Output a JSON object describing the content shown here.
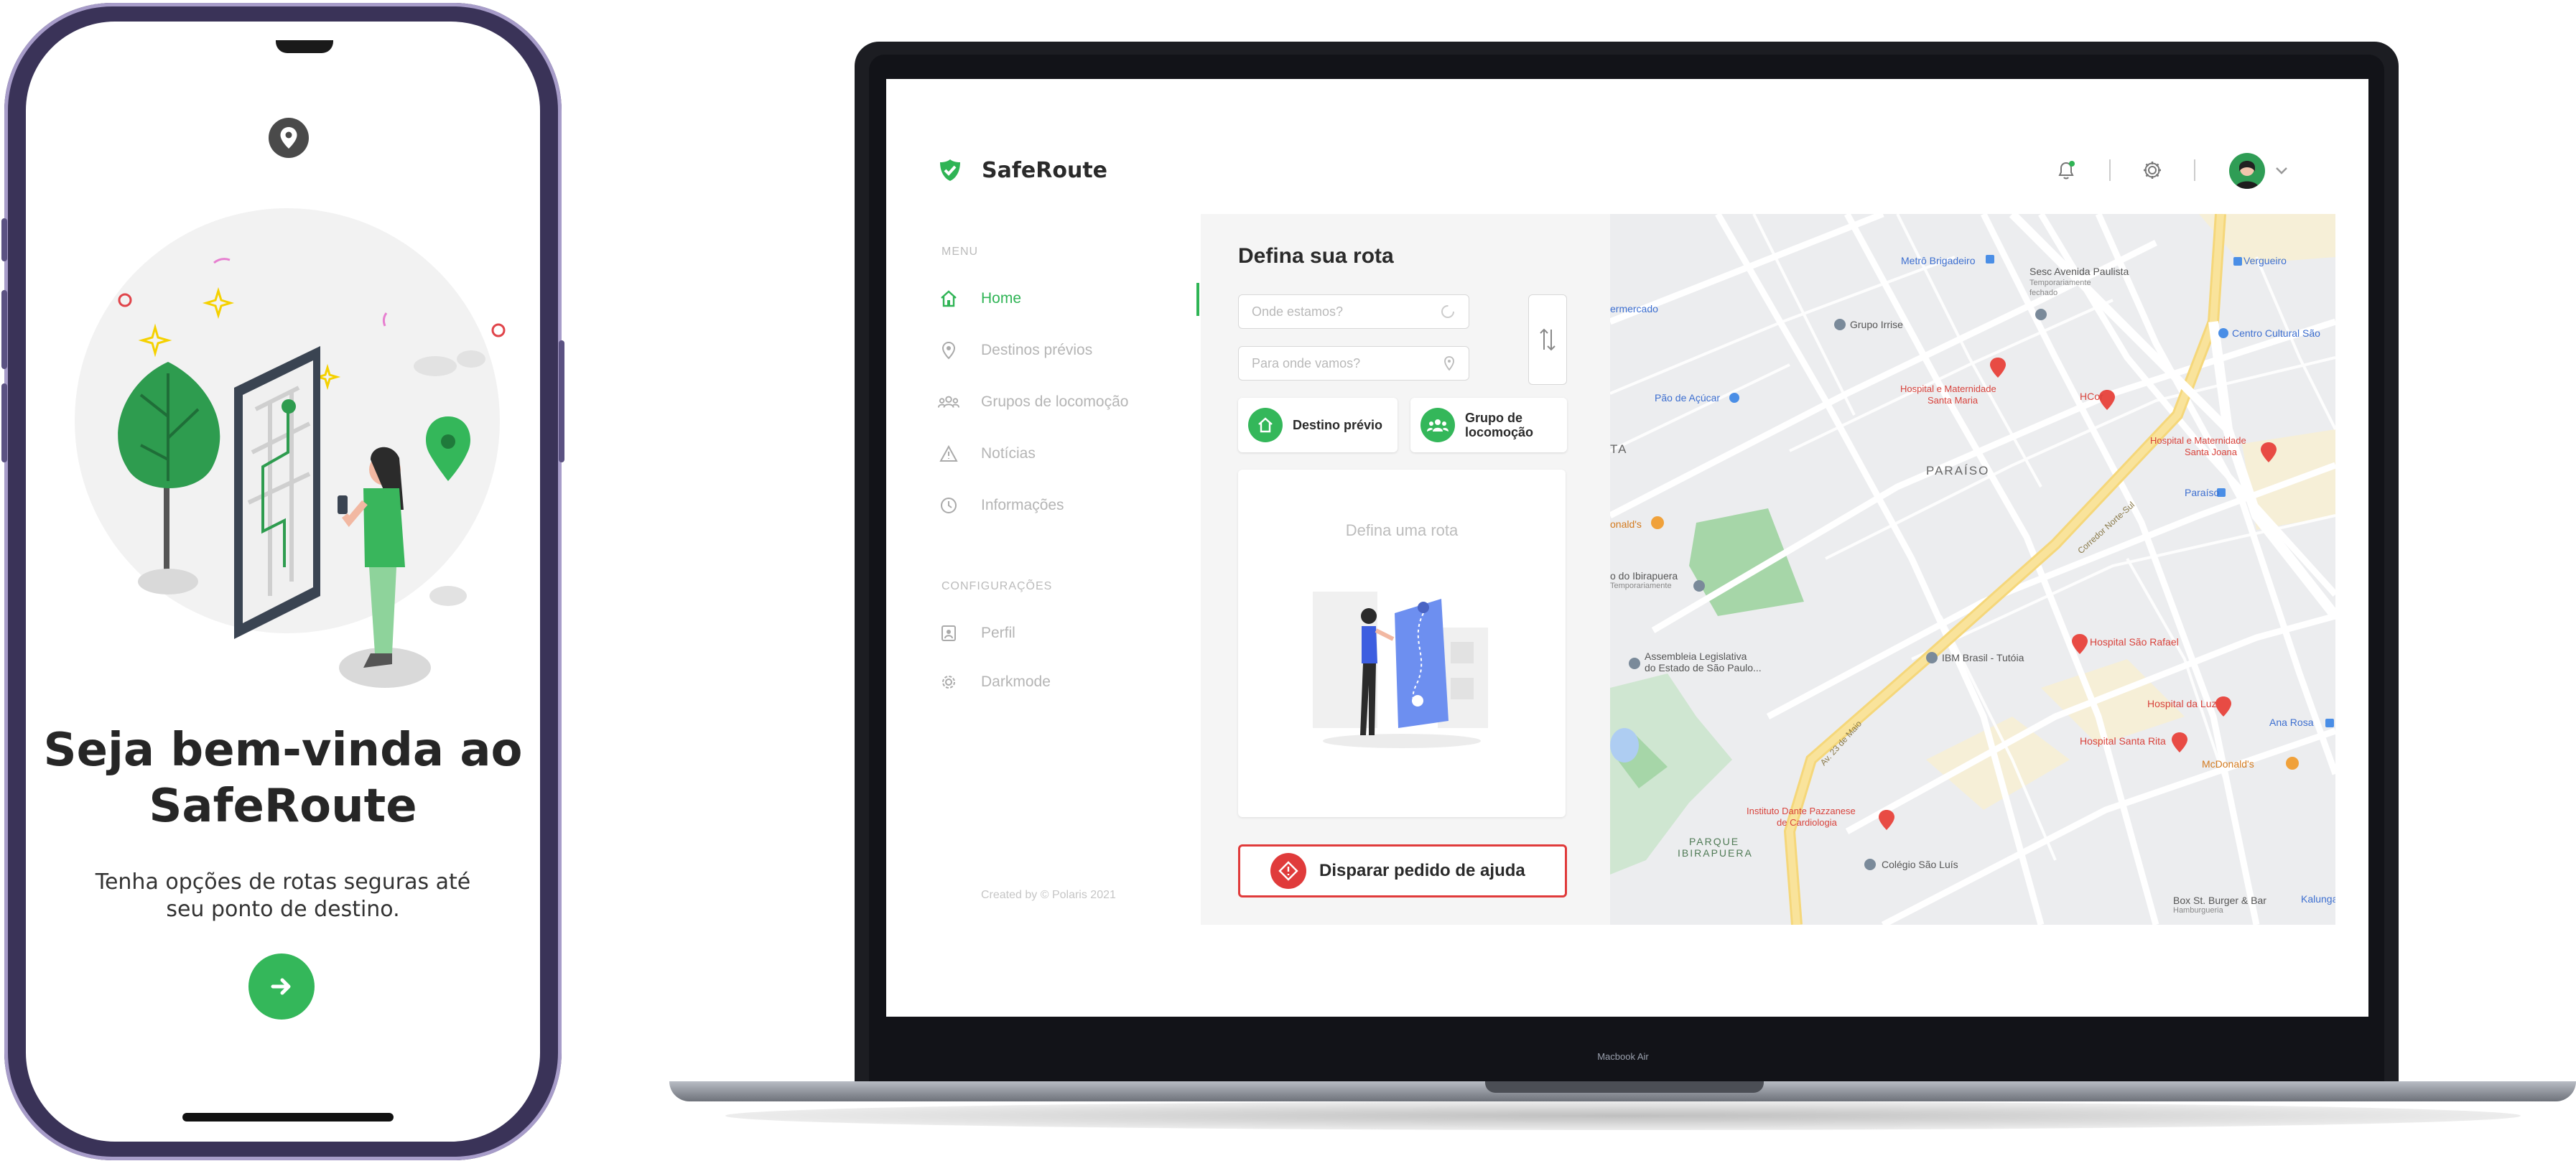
{
  "phone": {
    "title": "Seja bem-vinda ao SafeRoute",
    "subtitle": "Tenha opções de rotas seguras até seu ponto de destino."
  },
  "laptop_label": "Macbook Air",
  "app": {
    "brand": "SafeRoute",
    "accent": "#2fb455",
    "danger": "#e03b3b",
    "sidebar": {
      "menu_heading": "MENU",
      "items": [
        {
          "label": "Home",
          "icon": "home-icon",
          "active": true
        },
        {
          "label": "Destinos prévios",
          "icon": "location-pin-icon"
        },
        {
          "label": "Grupos de locomoção",
          "icon": "group-icon"
        },
        {
          "label": "Notícias",
          "icon": "warning-icon"
        },
        {
          "label": "Informações",
          "icon": "clock-icon"
        }
      ],
      "config_heading": "CONFIGURAÇÕES",
      "config_items": [
        {
          "label": "Perfil",
          "icon": "profile-icon"
        },
        {
          "label": "Darkmode",
          "icon": "gear-icon"
        }
      ],
      "footer": "Created by © Polaris 2021"
    },
    "route": {
      "title": "Defina sua rota",
      "origin_placeholder": "Onde estamos?",
      "destination_placeholder": "Para onde vamos?",
      "prev_destination": "Destino prévio",
      "group_line1": "Grupo de",
      "group_line2": "locomoção",
      "empty_text": "Defina uma rota",
      "help_button": "Disparar pedido de ajuda"
    },
    "map": {
      "places": {
        "metro_brigadeiro": "Metrô Brigadeiro",
        "sesc": "Sesc Avenida Paulista",
        "sesc_status1": "Temporariamente",
        "sesc_status2": "fechado",
        "vergueiro": "Vergueiro",
        "centro_cultural": "Centro Cultural São",
        "supermercado": "ermercado",
        "grupo_irrise": "Grupo Irrise",
        "hosp_santa_maria1": "Hospital e Maternidade",
        "hosp_santa_maria2": "Santa Maria",
        "hcor": "HCor",
        "pao_acucar": "Pão de Açúcar",
        "hosp_santa_joana1": "Hospital e Maternidade",
        "hosp_santa_joana2": "Santa Joana",
        "paraiso": "PARAÍSO",
        "paraiso_metro": "Paraíso",
        "ta": "TA",
        "mcdonalds1": "onald's",
        "ibirapuera1": "o do Ibirapuera",
        "ibirapuera2": "Temporariamente",
        "assembleia1": "Assembleia Legislativa",
        "assembleia2": "do Estado de São Paulo...",
        "ibm": "IBM Brasil - Tutóia",
        "hosp_sao_rafael": "Hospital São Rafael",
        "hosp_luz": "Hospital da Luz",
        "ana_rosa": "Ana Rosa",
        "hosp_santa_rita": "Hospital Santa Rita",
        "mcdonalds2": "McDonald's",
        "dante1": "Instituto Dante Pazzanese",
        "dante2": "de Cardiologia",
        "parque1": "PARQUE",
        "parque2": "IBIRAPUERA",
        "colegio": "Colégio São Luís",
        "box1": "Box St. Burger & Bar",
        "box2": "Hamburgueria",
        "kalunga": "Kalunga",
        "av_23": "Av. 23 de Maio",
        "corredor": "Corredor Norte-Sul"
      }
    }
  }
}
